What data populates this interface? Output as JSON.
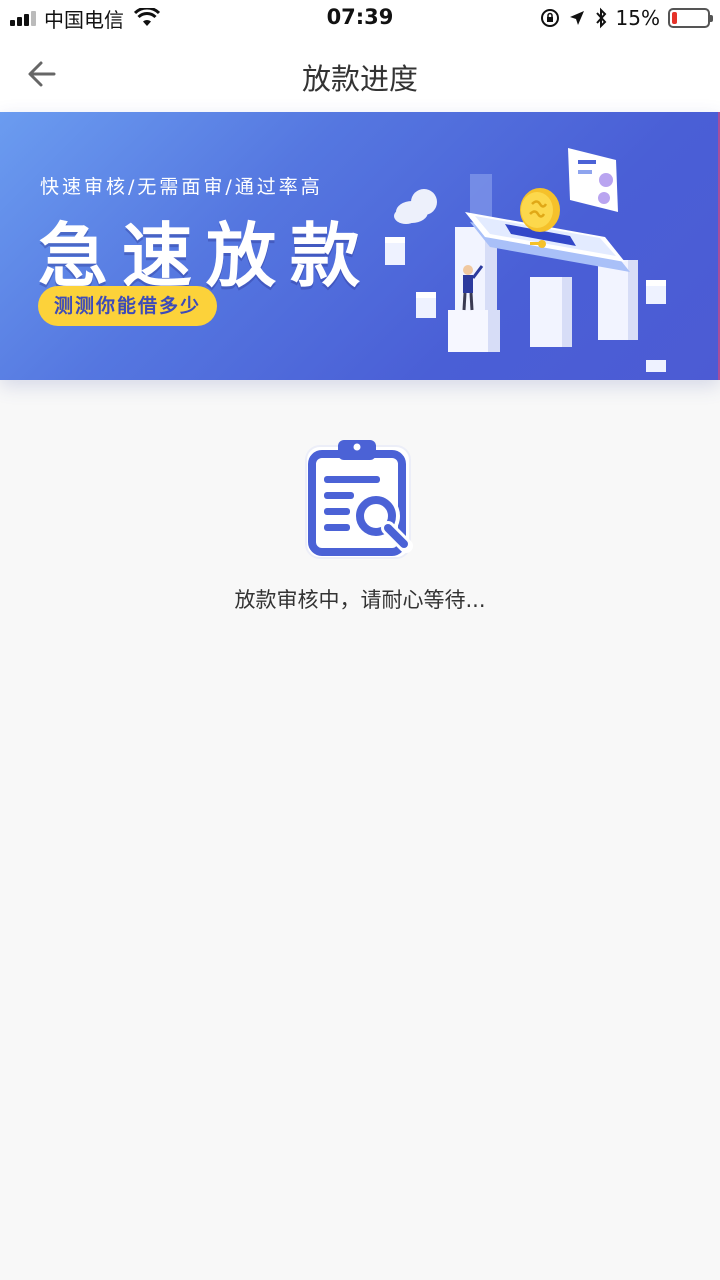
{
  "status_bar": {
    "carrier": "中国电信",
    "time": "07:39",
    "battery_percent": "15%",
    "battery_level": 0.15,
    "icons": [
      "signal-icon",
      "wifi-icon",
      "orientation-lock-icon",
      "location-icon",
      "bluetooth-icon",
      "battery-icon"
    ]
  },
  "nav": {
    "title": "放款进度",
    "back_icon": "arrow-left-icon"
  },
  "banner": {
    "subtitle": "快速审核/无需面审/通过率高",
    "headline": "急速放款",
    "cta_label": "测测你能借多少",
    "colors": {
      "background": "#4f64d8",
      "cta": "#fcd23a",
      "cta_text": "#3d4bb8"
    }
  },
  "status": {
    "icon": "clipboard-search-icon",
    "message": "放款审核中，请耐心等待...",
    "accent_color": "#4b62d6"
  }
}
